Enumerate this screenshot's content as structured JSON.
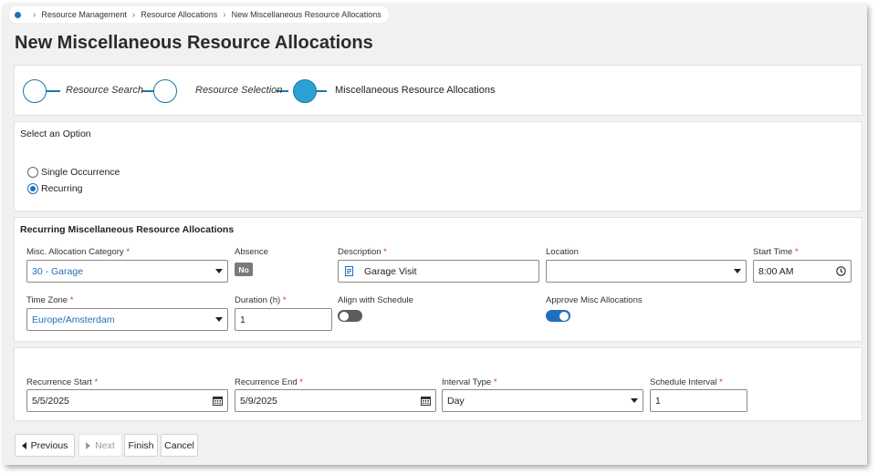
{
  "breadcrumb": {
    "items": [
      "Resource Management",
      "Resource Allocations",
      "New Miscellaneous Resource Allocations"
    ]
  },
  "page": {
    "title": "New Miscellaneous Resource Allocations"
  },
  "wizard": {
    "steps": [
      {
        "label": "Resource Search",
        "state": "done"
      },
      {
        "label": "Resource Selection",
        "state": "done"
      },
      {
        "label": "Miscellaneous Resource Allocations",
        "state": "current"
      }
    ]
  },
  "option_section": {
    "title": "Select an Option",
    "options": [
      {
        "label": "Single Occurrence",
        "checked": false
      },
      {
        "label": "Recurring",
        "checked": true
      }
    ]
  },
  "recurring_section": {
    "title": "Recurring Miscellaneous Resource Allocations",
    "category": {
      "label": "Misc. Allocation Category",
      "required": "*",
      "value": "30 - Garage"
    },
    "absence": {
      "label": "Absence",
      "value": "No"
    },
    "description": {
      "label": "Description",
      "required": "*",
      "value": "Garage Visit"
    },
    "location": {
      "label": "Location",
      "value": ""
    },
    "start_time": {
      "label": "Start Time",
      "required": "*",
      "value": "8:00 AM"
    },
    "time_zone": {
      "label": "Time Zone",
      "required": "*",
      "value": "Europe/Amsterdam"
    },
    "duration": {
      "label": "Duration (h)",
      "required": "*",
      "value": "1"
    },
    "align_schedule": {
      "label": "Align with Schedule",
      "on": false
    },
    "approve": {
      "label": "Approve Misc Allocations",
      "on": true
    }
  },
  "recurrence_section": {
    "start": {
      "label": "Recurrence Start",
      "required": "*",
      "value": "5/5/2025"
    },
    "end": {
      "label": "Recurrence End",
      "required": "*",
      "value": "5/9/2025"
    },
    "interval_type": {
      "label": "Interval Type",
      "required": "*",
      "value": "Day"
    },
    "schedule_interval": {
      "label": "Schedule Interval",
      "required": "*",
      "value": "1"
    }
  },
  "footer": {
    "previous": "Previous",
    "next": "Next",
    "finish": "Finish",
    "cancel": "Cancel"
  },
  "colors": {
    "accent": "#1f6fbf",
    "wizard_active": "#2ba2d6",
    "required": "#d0342c"
  }
}
